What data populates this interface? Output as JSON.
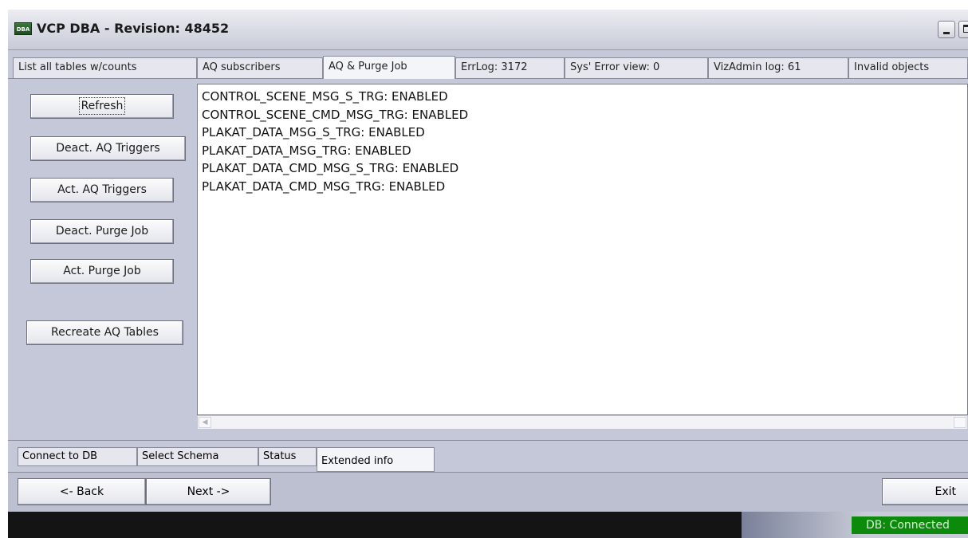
{
  "window": {
    "title": "VCP DBA  - Revision: 48452",
    "icon_label": "DBA"
  },
  "top_tabs": [
    {
      "label": "List all tables w/counts",
      "active": false
    },
    {
      "label": "AQ subscribers",
      "active": false
    },
    {
      "label": "AQ & Purge Job",
      "active": true
    },
    {
      "label": "ErrLog: 3172",
      "active": false
    },
    {
      "label": "Sys' Error view: 0",
      "active": false
    },
    {
      "label": "VizAdmin log: 61",
      "active": false
    },
    {
      "label": "Invalid objects",
      "active": false
    }
  ],
  "action_buttons": {
    "refresh": "Refresh",
    "deact_aq_triggers": "Deact. AQ Triggers",
    "act_aq_triggers": "Act. AQ Triggers",
    "deact_purge_job": "Deact. Purge Job",
    "act_purge_job": "Act. Purge Job",
    "recreate_aq_tables": "Recreate AQ Tables"
  },
  "output": {
    "lines": [
      "CONTROL_SCENE_MSG_S_TRG: ENABLED",
      "CONTROL_SCENE_CMD_MSG_TRG: ENABLED",
      "PLAKAT_DATA_MSG_S_TRG: ENABLED",
      "PLAKAT_DATA_MSG_TRG: ENABLED",
      "PLAKAT_DATA_CMD_MSG_S_TRG: ENABLED",
      "PLAKAT_DATA_CMD_MSG_TRG: ENABLED"
    ]
  },
  "bottom_tabs": [
    {
      "label": "Connect to DB",
      "active": false
    },
    {
      "label": "Select Schema",
      "active": false
    },
    {
      "label": "Status",
      "active": false
    },
    {
      "label": "Extended info",
      "active": true
    }
  ],
  "nav": {
    "back": "<- Back",
    "next": "Next ->",
    "exit": "Exit"
  },
  "status": {
    "db_status": "DB: Connected",
    "db_status_color": "#0b8a0b"
  }
}
